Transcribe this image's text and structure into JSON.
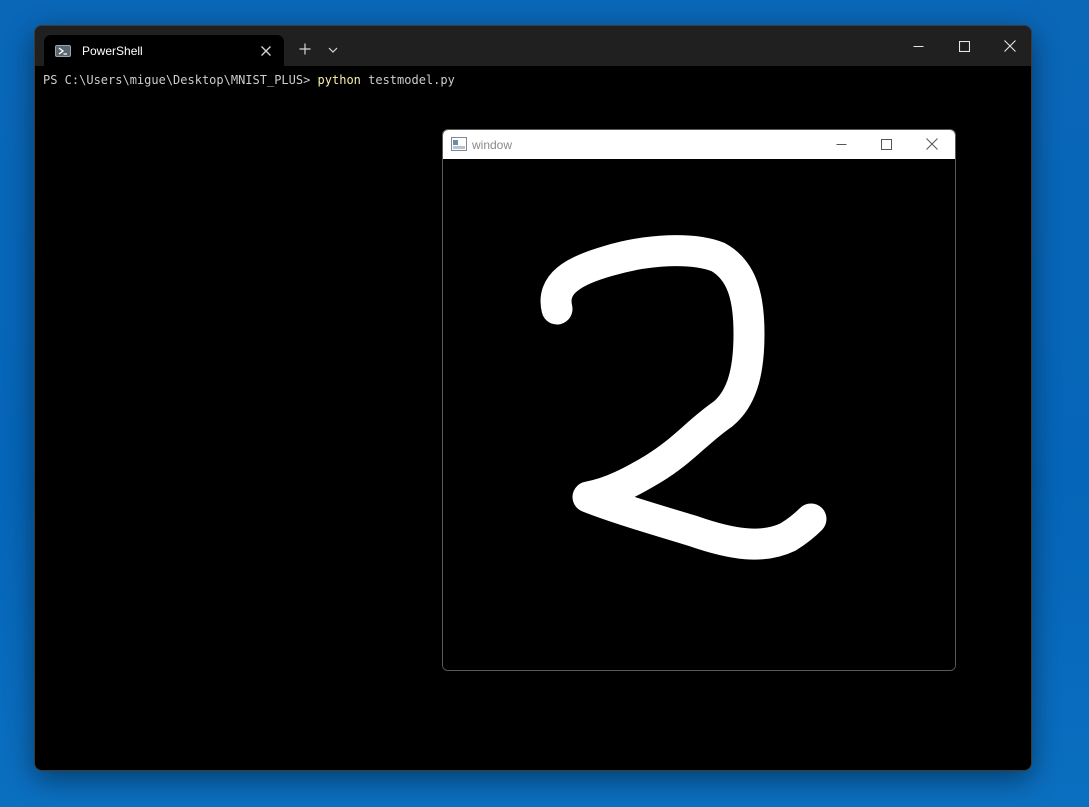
{
  "terminal": {
    "tab_title": "PowerShell",
    "icons": {
      "tab": "powershell-icon",
      "close_tab": "close-icon",
      "new_tab": "plus-icon",
      "dropdown": "chevron-down-icon",
      "minimize": "minimize-icon",
      "maximize": "maximize-icon",
      "close": "close-icon"
    },
    "prompt": "PS C:\\Users\\migue\\Desktop\\MNIST_PLUS> ",
    "command": "python",
    "args": " testmodel.py"
  },
  "cv_window": {
    "title": "window",
    "icons": {
      "app": "window-app-icon",
      "minimize": "minimize-icon",
      "maximize": "maximize-icon",
      "close": "close-icon"
    },
    "drawing": "handwritten digit 2",
    "colors": {
      "background": "#000000",
      "stroke": "#ffffff"
    }
  },
  "colors": {
    "desktop": "#0565b8",
    "terminal_bg": "#000000",
    "titlebar": "#202020",
    "command": "#f9f1a5"
  }
}
